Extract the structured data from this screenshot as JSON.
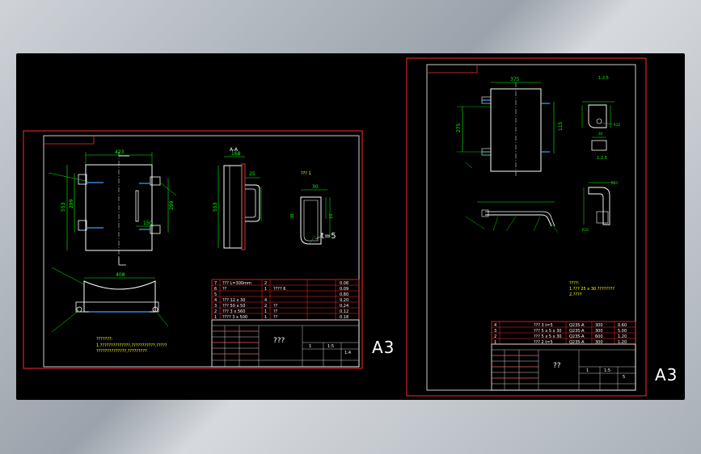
{
  "colors": {
    "sheet_border": "#ff2020",
    "drawing": "#ffffff",
    "dimension": "#00ff00",
    "note": "#ffff00",
    "background": "#000000"
  },
  "left_sheet": {
    "size_label": "A3",
    "view_label": "A-A",
    "detail_label": "??? 1",
    "dims": {
      "width": "423",
      "height": "553",
      "inner": "299",
      "side": "150",
      "top": "168",
      "depth": "25",
      "lower": "408"
    },
    "thickness_label": "t=5",
    "notes": [
      "???????:",
      "1.??????????????,???????????,?????",
      "??????????????,?????????"
    ],
    "parts_table": [
      [
        "7",
        "??? L=300mm",
        "2",
        "",
        "0.06"
      ],
      [
        "6",
        "??",
        "1",
        "???? 6",
        "0.09"
      ],
      [
        "5",
        "",
        "",
        "",
        "0.80"
      ],
      [
        "4",
        "??? 12 x 30",
        "4",
        "",
        "9.20"
      ],
      [
        "3",
        "??? 50 x 50",
        "2",
        "??",
        "0.24"
      ],
      [
        "2",
        "??? 3 x 560",
        "1",
        "??",
        "0.12"
      ],
      [
        "1",
        "???? 3 x 500",
        "1",
        "??",
        "0.18"
      ]
    ],
    "title_text": "???",
    "sheet_info": [
      "1",
      "1:5",
      "1:4"
    ]
  },
  "right_sheet": {
    "size_label": "A3",
    "dims": {
      "width": "375",
      "height": "275",
      "side": "115",
      "detail_a": "1:2.5",
      "detail_b": "1:2.5",
      "r1": "R10",
      "r2": "R20"
    },
    "notes": [
      "????:",
      "1.??? 25 x 30 ????????",
      "2.????"
    ],
    "parts_table": [
      [
        "4",
        "??? 3 t=5",
        "Q235-A",
        "300",
        "0.60"
      ],
      [
        "3",
        "??? 5 x 5 x 30",
        "Q235-A",
        "300",
        "5.00"
      ],
      [
        "2",
        "??? 5 x 5 x 30",
        "Q235-A",
        "600",
        "1.20"
      ],
      [
        "1",
        "??? 2 t=5",
        "Q235-A",
        "300",
        "1.20"
      ]
    ],
    "title_text": "??",
    "sheet_info": [
      "1",
      "1:5",
      "5"
    ]
  }
}
